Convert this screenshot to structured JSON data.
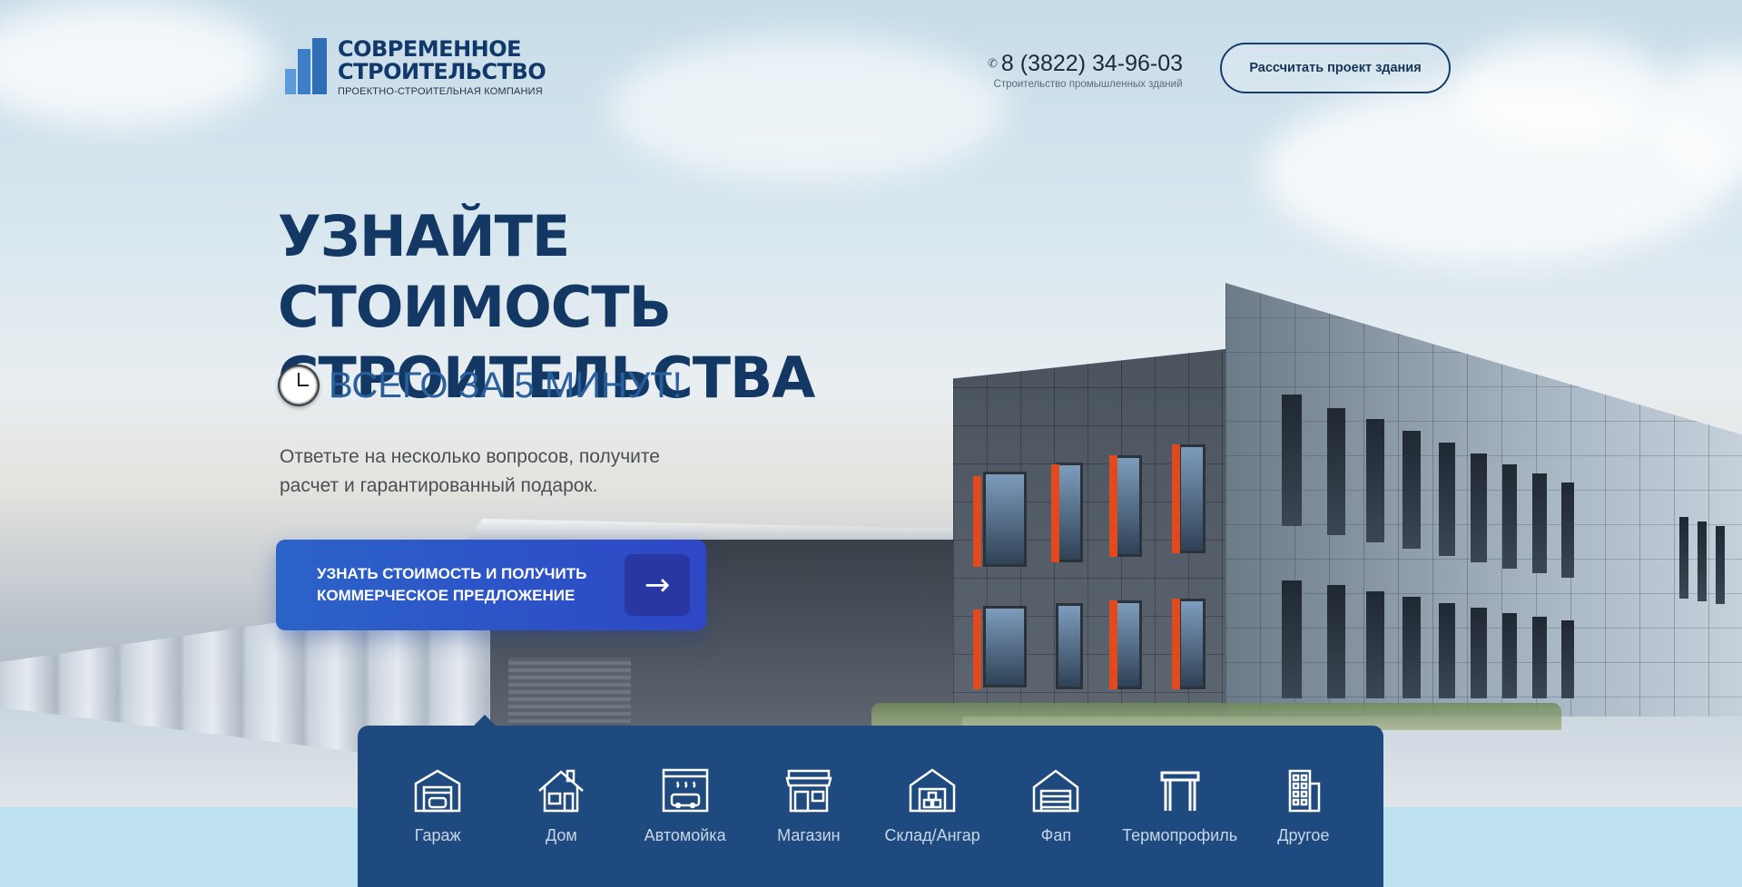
{
  "header": {
    "logo_title_line1": "СОВРЕМЕННОЕ",
    "logo_title_line2": "СТРОИТЕЛЬСТВО",
    "logo_subtitle": "ПРОЕКТНО-СТРОИТЕЛЬНАЯ КОМПАНИЯ",
    "phone": "8 (3822) 34-96-03",
    "phone_caption": "Строительство промышленных зданий",
    "calc_button_label": "Рассчитать проект здания"
  },
  "hero": {
    "title_line1": "УЗНАЙТЕ СТОИМОСТЬ",
    "title_line2": "СТРОИТЕЛЬСТВА",
    "subtitle": "ВСЕГО ЗА 5 МИНУТ!",
    "lead_line1": "Ответьте на несколько вопросов, получите",
    "lead_line2": "расчет и гарантированный подарок.",
    "cta_line1": "УЗНАТЬ СТОИМОСТЬ И ПОЛУЧИТЬ",
    "cta_line2": "КОММЕРЧЕСКОЕ ПРЕДЛОЖЕНИЕ",
    "cta_arrow": "→"
  },
  "categories": [
    {
      "label": "Гараж",
      "icon": "garage-icon"
    },
    {
      "label": "Дом",
      "icon": "house-icon"
    },
    {
      "label": "Автомойка",
      "icon": "car-wash-icon"
    },
    {
      "label": "Магазин",
      "icon": "shop-icon"
    },
    {
      "label": "Склад/Ангар",
      "icon": "warehouse-icon"
    },
    {
      "label": "Фап",
      "icon": "hangar-icon"
    },
    {
      "label": "Термопрофиль",
      "icon": "frame-icon"
    },
    {
      "label": "Другое",
      "icon": "building-icon"
    }
  ],
  "colors": {
    "brand_dark": "#123863",
    "accent_blue": "#2b63c8",
    "panel": "#1e4a7f"
  }
}
